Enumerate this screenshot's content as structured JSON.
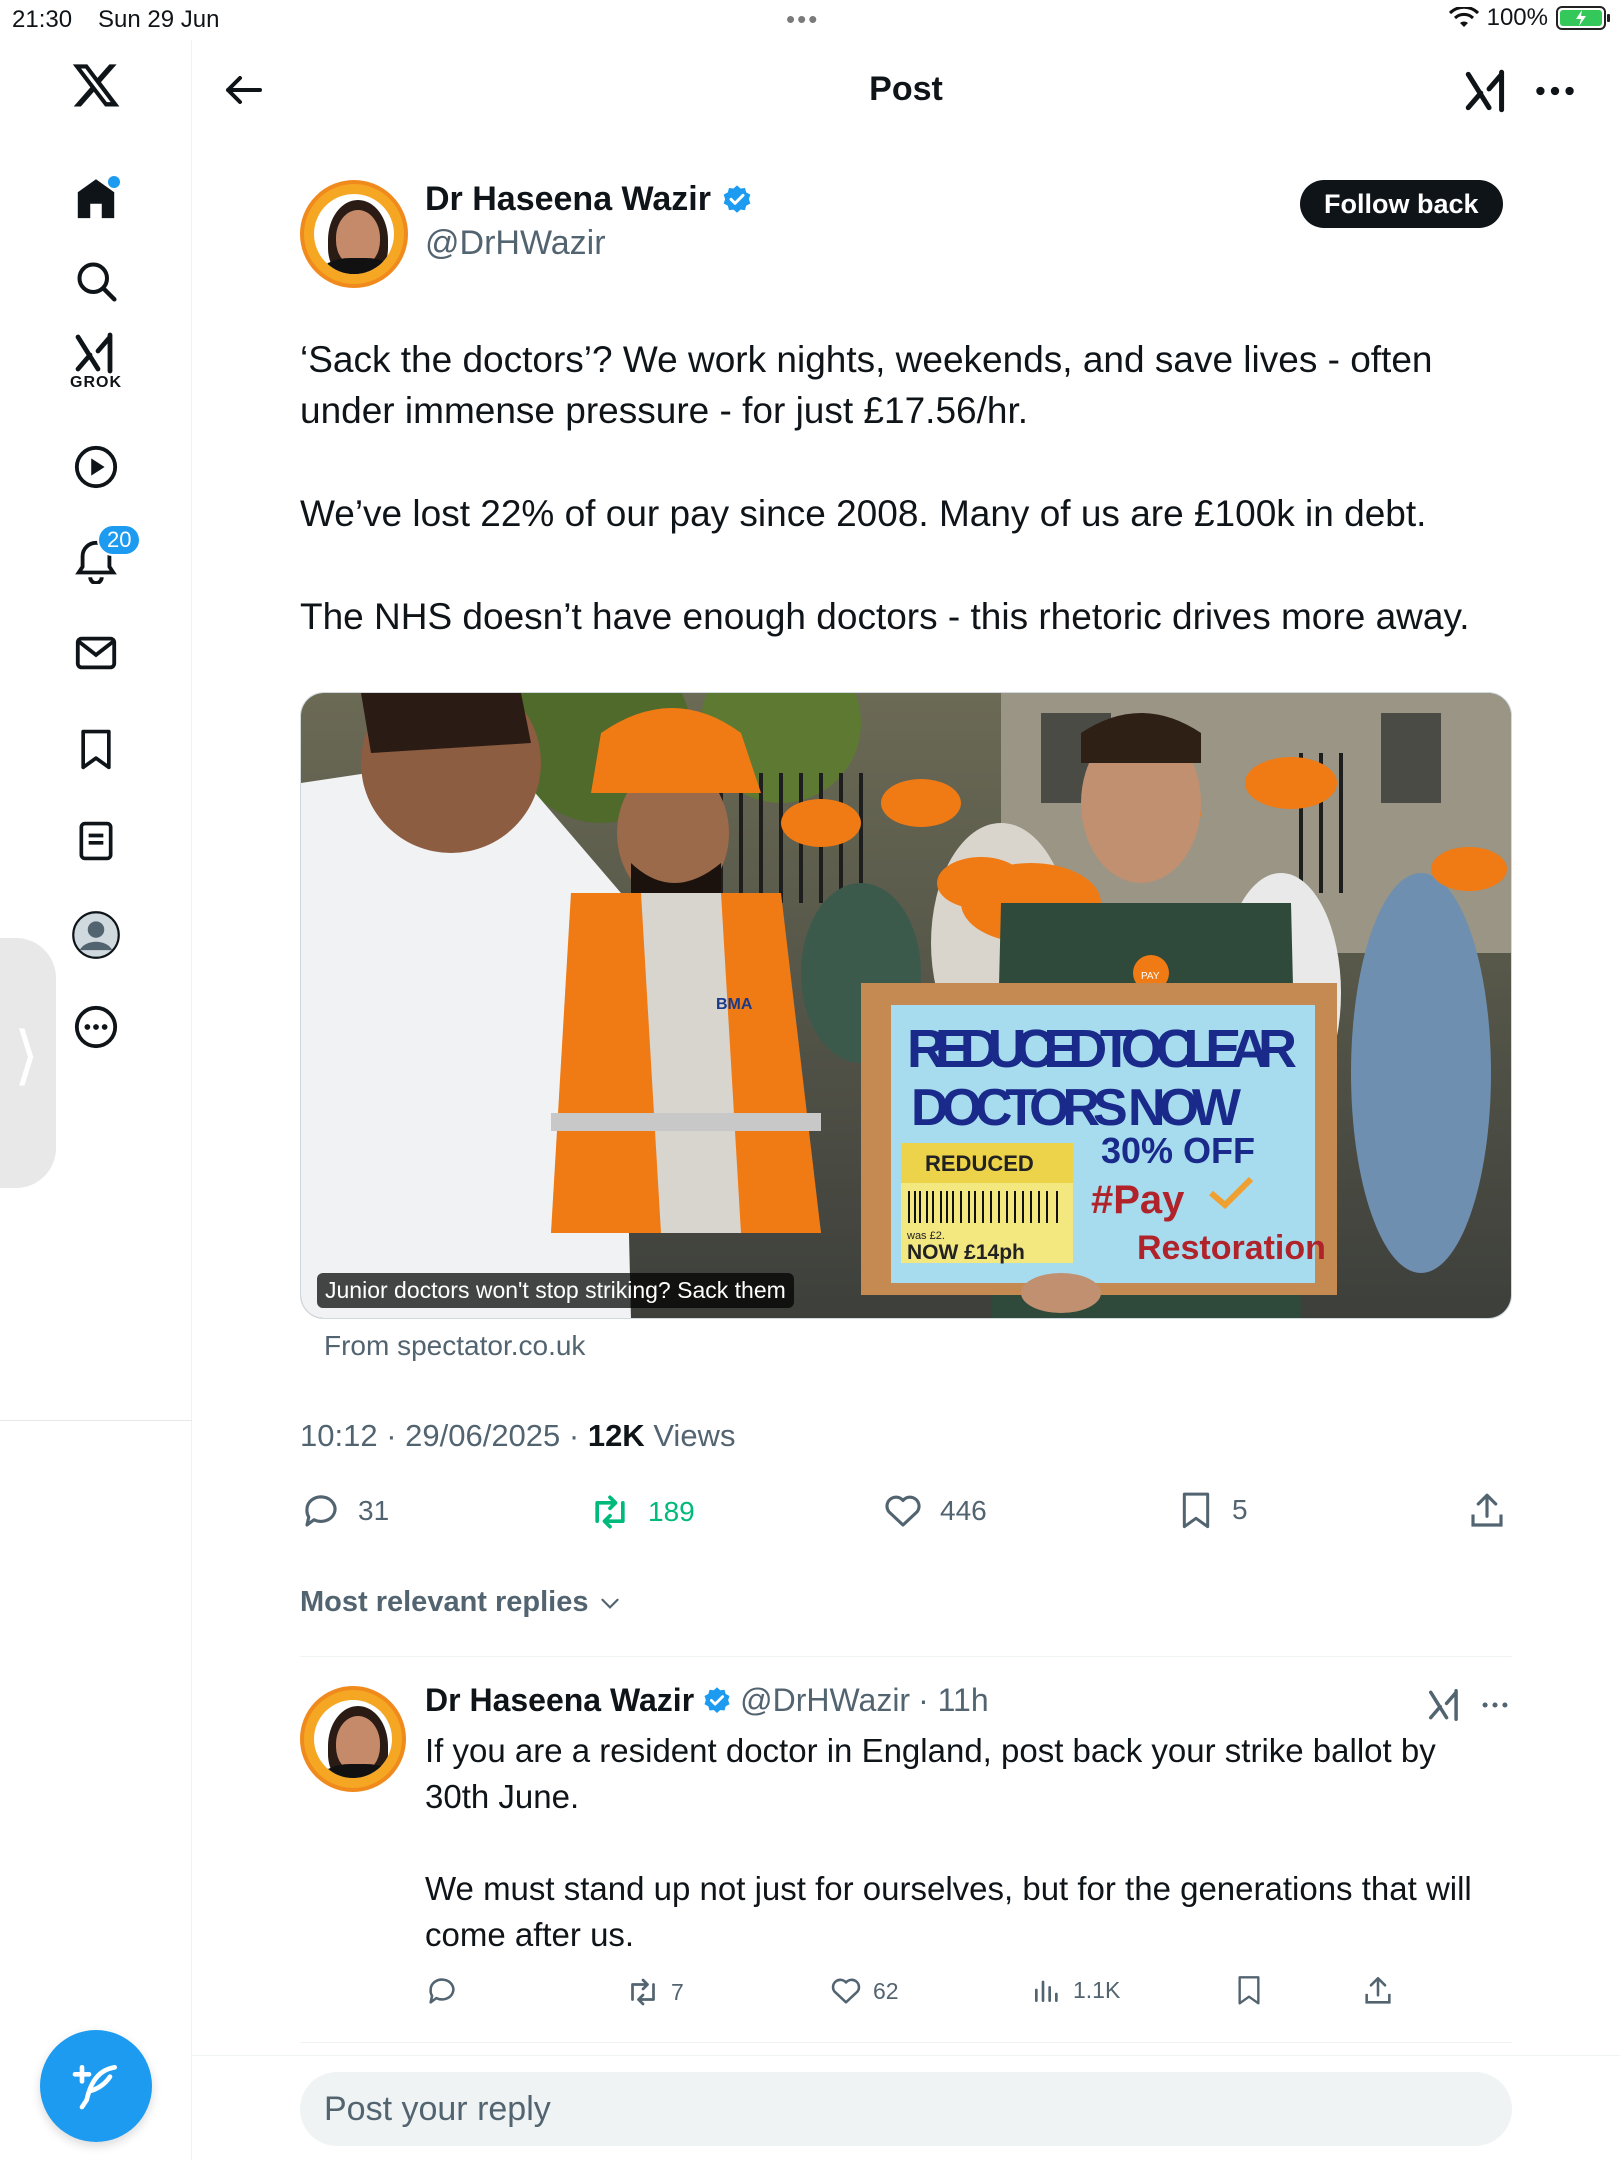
{
  "status_bar": {
    "time": "21:30",
    "date": "Sun 29 Jun",
    "battery": "100%"
  },
  "sidebar": {
    "items": [
      {
        "icon": "x-logo-icon"
      },
      {
        "icon": "home-icon"
      },
      {
        "icon": "search-icon"
      },
      {
        "icon": "grok-icon",
        "label": "GROK"
      },
      {
        "icon": "video-icon"
      },
      {
        "icon": "notifications-icon",
        "badge": "20"
      },
      {
        "icon": "messages-icon"
      },
      {
        "icon": "bookmarks-icon"
      },
      {
        "icon": "lists-icon"
      },
      {
        "icon": "profile-icon"
      },
      {
        "icon": "more-icon"
      }
    ],
    "compose_icon": "compose-icon"
  },
  "header": {
    "title": "Post"
  },
  "post": {
    "author_name": "Dr Haseena Wazir",
    "author_handle": "@DrHWazir",
    "follow_label": "Follow back",
    "paragraphs": [
      "‘Sack the doctors’? We work nights, weekends, and save lives - often under immense pressure - for just £17.56/hr.",
      "We’ve lost 22% of our pay since 2008. Many of us are £100k in debt.",
      "The NHS doesn’t have enough doctors - this rhetoric drives more away."
    ],
    "media": {
      "caption": "Junior doctors won't stop striking? Sack them",
      "source": "From spectator.co.uk",
      "sign": {
        "line1": "REDUCED TO CLEAR",
        "line2": "DOCTORS NOW",
        "tag": "REDUCED",
        "was": "was £2.",
        "now": "NOW £14ph",
        "off": "30% OFF",
        "hashtag1": "#Pay",
        "hashtag2": "Restoration"
      },
      "vest_text": "BMA",
      "badge_text": "PAY"
    },
    "time": "10:12 · 29/06/2025 · ",
    "views_count": "12K",
    "views_label": " Views",
    "stats": {
      "replies": "31",
      "reposts": "189",
      "likes": "446",
      "bookmarks": "5"
    }
  },
  "sort_label": "Most relevant replies",
  "reply": {
    "author_name": "Dr Haseena Wazir",
    "author_handle": "@DrHWazir",
    "age": "· 11h",
    "paragraphs": [
      "If you are a resident doctor in England, post back your strike ballot by 30th June.",
      "We must stand up not just for ourselves, but for the generations that will come after us."
    ],
    "stats": {
      "reposts": "7",
      "likes": "62",
      "views": "1.1K"
    }
  },
  "composer": {
    "placeholder": "Post your reply"
  }
}
